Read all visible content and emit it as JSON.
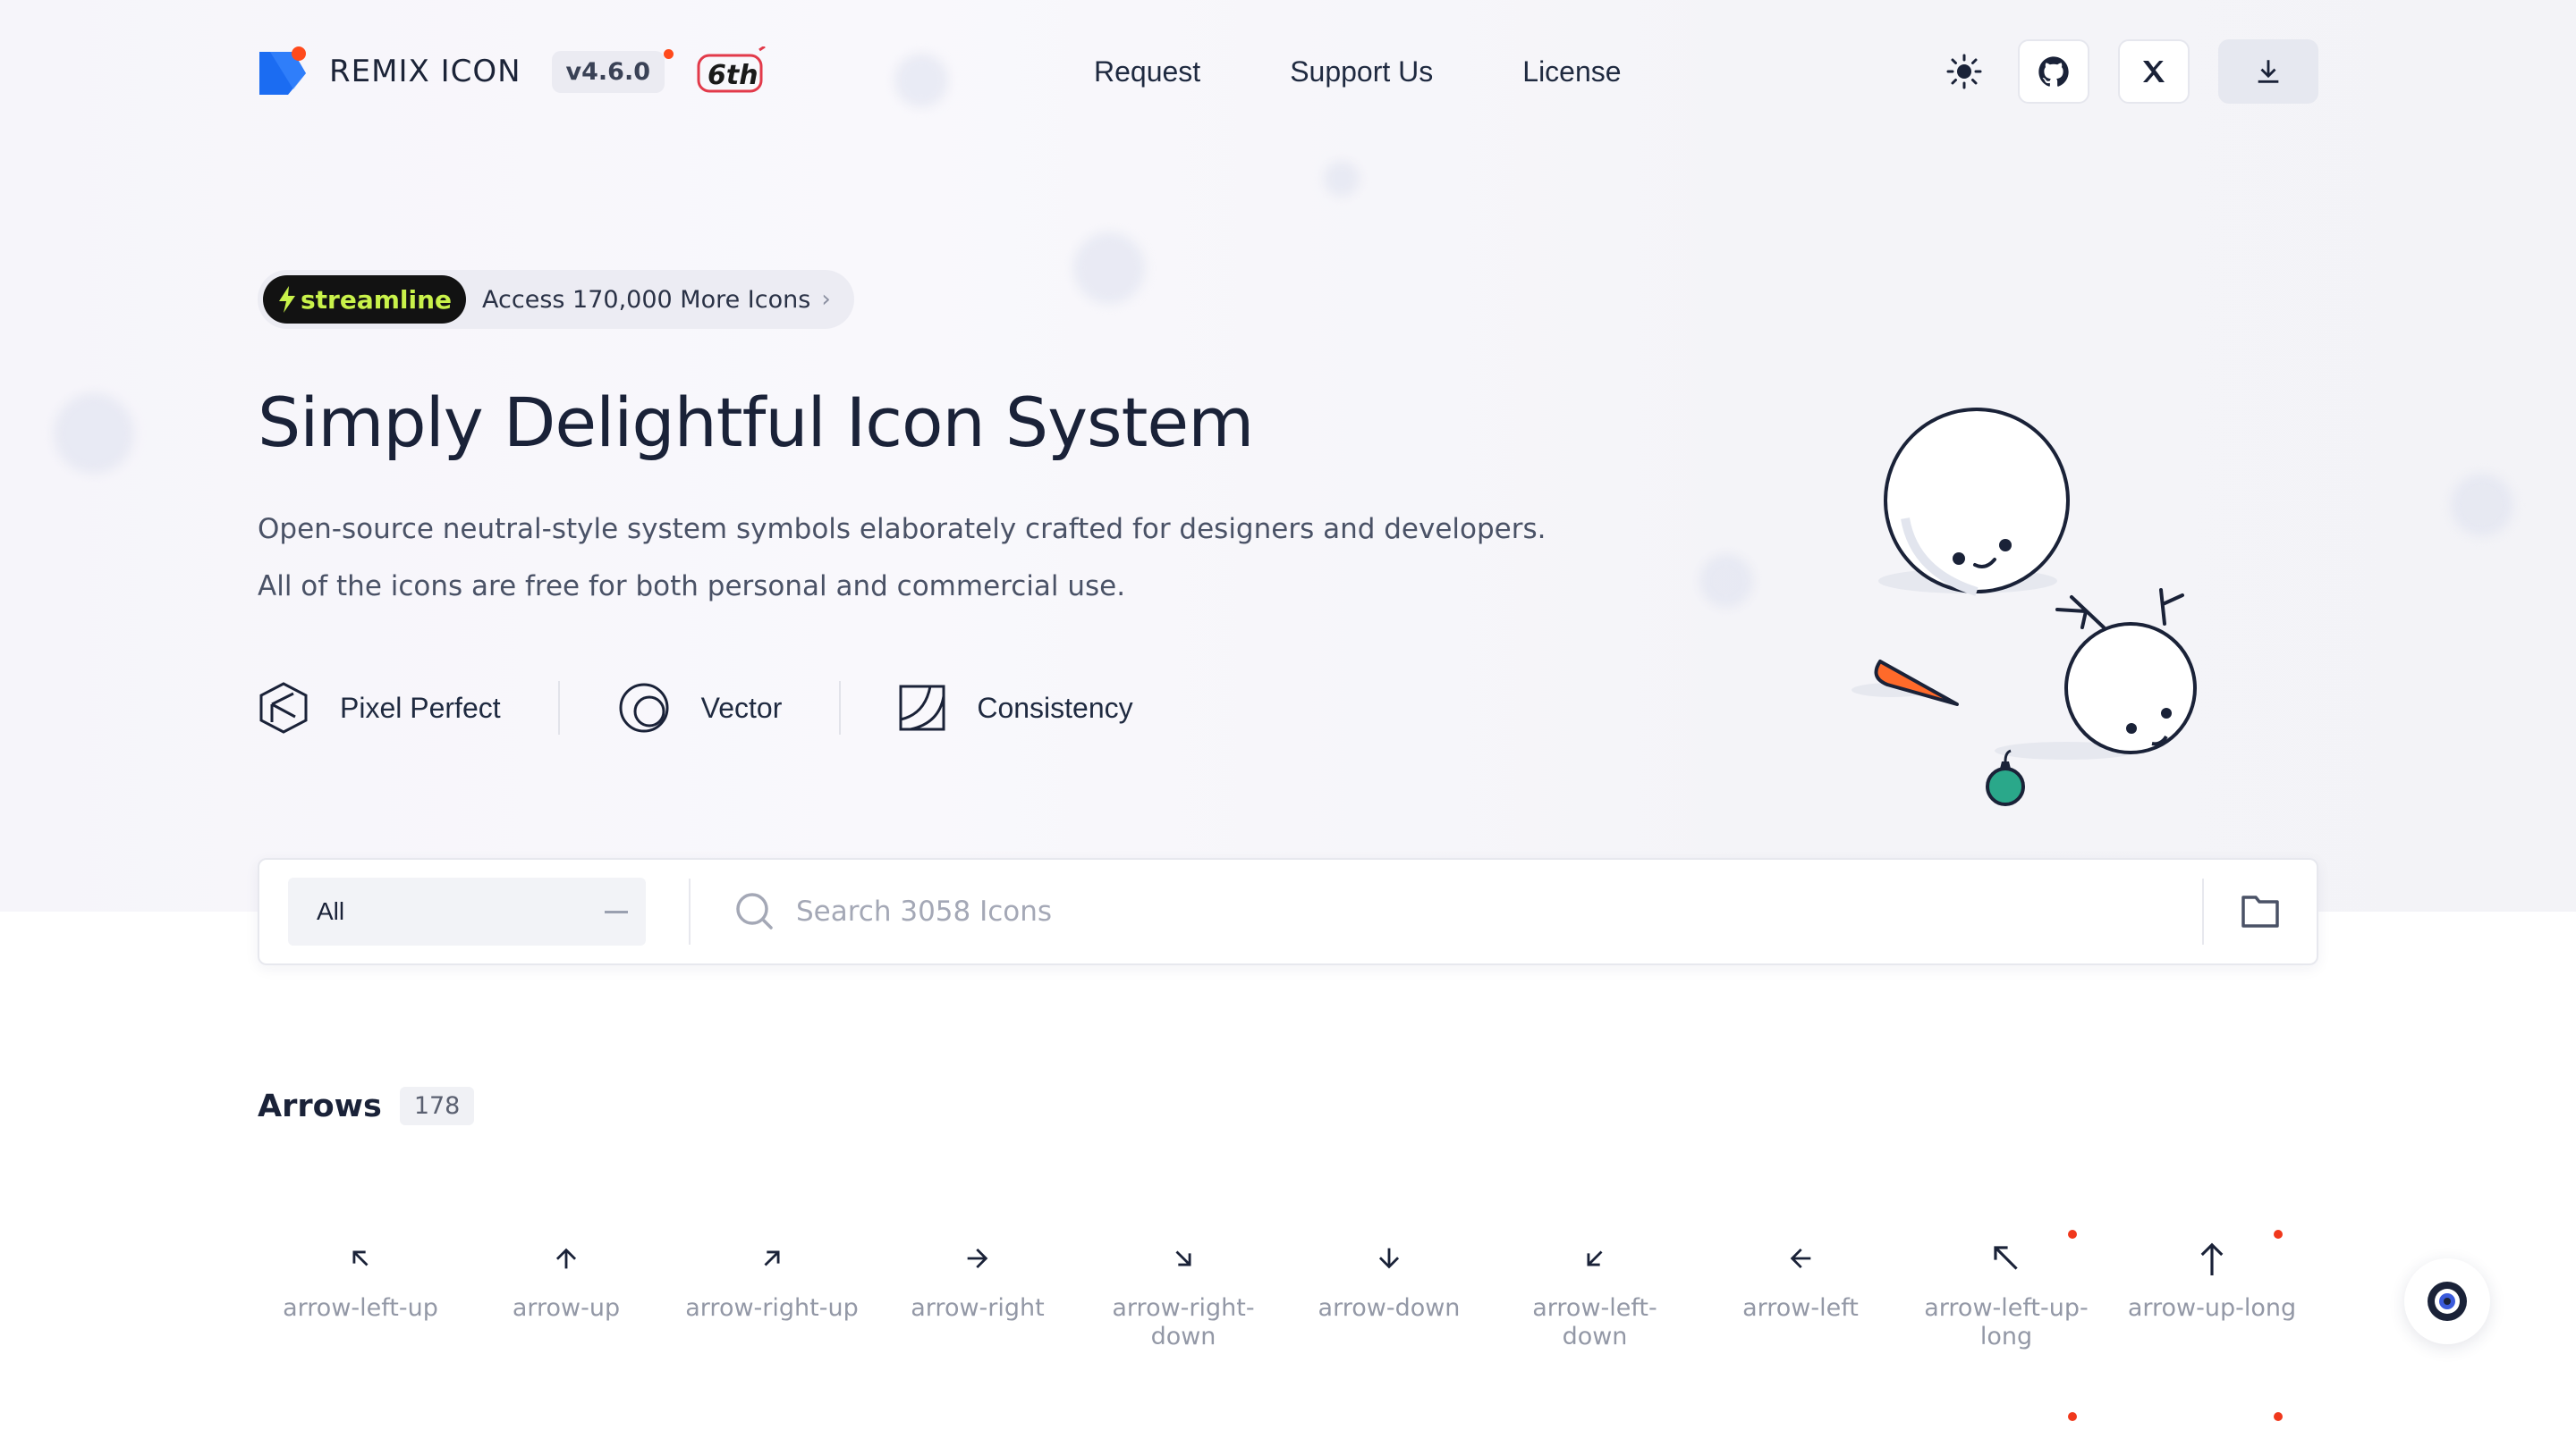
{
  "header": {
    "brand": "REMIX ICON",
    "version": "v4.6.0",
    "anniversary": "6th",
    "nav": [
      "Request",
      "Support Us",
      "License"
    ],
    "actions": [
      "theme-icon",
      "github-icon",
      "x-icon",
      "download-icon"
    ]
  },
  "promo": {
    "tag": "streamline",
    "text": "Access 170,000 More Icons"
  },
  "hero": {
    "title": "Simply Delightful Icon System",
    "subtitle_1": "Open-source neutral-style system symbols elaborately crafted for designers and developers.",
    "subtitle_2": "All of the icons are free for both personal and commercial use."
  },
  "features": [
    {
      "label": "Pixel Perfect",
      "icon": "cube-icon"
    },
    {
      "label": "Vector",
      "icon": "vector-circle-icon"
    },
    {
      "label": "Consistency",
      "icon": "consistency-square-icon"
    }
  ],
  "search": {
    "category_selected": "All",
    "placeholder": "Search 3058 Icons"
  },
  "category": {
    "title": "Arrows",
    "count": "178"
  },
  "icons": [
    {
      "name": "arrow-left-up",
      "icon": "arrow-left-up-icon"
    },
    {
      "name": "arrow-up",
      "icon": "arrow-up-icon"
    },
    {
      "name": "arrow-right-up",
      "icon": "arrow-right-up-icon"
    },
    {
      "name": "arrow-right",
      "icon": "arrow-right-icon"
    },
    {
      "name": "arrow-right-down",
      "icon": "arrow-right-down-icon"
    },
    {
      "name": "arrow-down",
      "icon": "arrow-down-icon"
    },
    {
      "name": "arrow-left-down",
      "icon": "arrow-left-down-icon"
    },
    {
      "name": "arrow-left",
      "icon": "arrow-left-icon"
    },
    {
      "name": "arrow-left-up-long",
      "icon": "arrow-left-up-long-icon"
    },
    {
      "name": "arrow-up-long",
      "icon": "arrow-up-long-icon"
    }
  ],
  "colors": {
    "text": "#1a2238",
    "muted": "#9398a6",
    "logo_blue": "#1b6cf2",
    "accent_red": "#ff4a1c",
    "streamline_green": "#c9f24a"
  }
}
